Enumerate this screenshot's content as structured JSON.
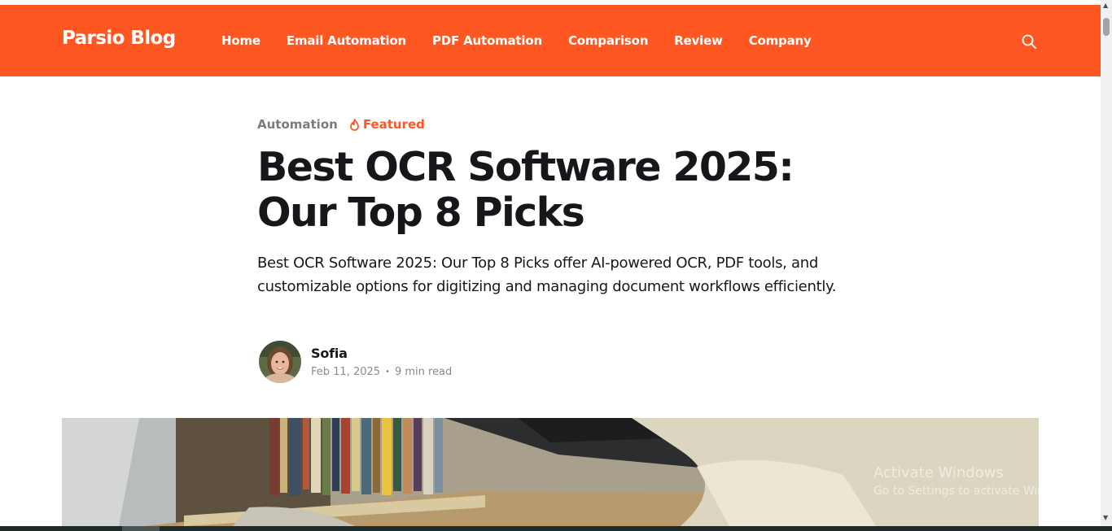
{
  "colors": {
    "brand": "#ff5722",
    "text": "#15171a",
    "muted": "#8a8a8a"
  },
  "header": {
    "logo": "Parsio Blog",
    "nav": [
      "Home",
      "Email Automation",
      "PDF Automation",
      "Comparison",
      "Review",
      "Company"
    ],
    "search_icon": "search-icon"
  },
  "article": {
    "tag": "Automation",
    "featured_label": "Featured",
    "featured_icon": "flame-icon",
    "title_line1": "Best OCR Software 2025:",
    "title_line2": "Our Top 8 Picks",
    "excerpt": "Best OCR Software 2025: Our Top 8 Picks offer AI-powered OCR, PDF tools, and customizable options for digitizing and managing document workflows efficiently.",
    "author": {
      "name": "Sofia",
      "date": "Feb 11, 2025",
      "separator": "•",
      "read_time": "9 min read"
    }
  },
  "watermark": {
    "title": "Activate Windows",
    "subtitle": "Go to Settings to activate Windows."
  }
}
